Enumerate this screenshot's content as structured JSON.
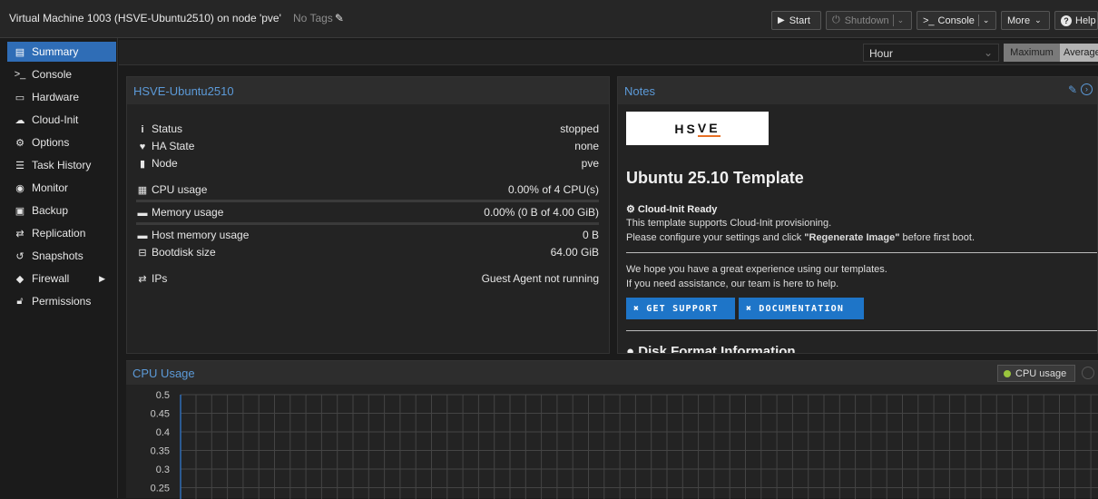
{
  "topbar": {
    "title": "Virtual Machine 1003 (HSVE-Ubuntu2510) on node 'pve'",
    "tags": "No Tags",
    "buttons": {
      "start": "Start",
      "shutdown": "Shutdown",
      "console": "Console",
      "more": "More",
      "help": "Help"
    }
  },
  "sidebar": {
    "items": [
      {
        "label": "Summary",
        "icon": "summary-icon"
      },
      {
        "label": "Console",
        "icon": "terminal-icon"
      },
      {
        "label": "Hardware",
        "icon": "monitor-icon"
      },
      {
        "label": "Cloud-Init",
        "icon": "cloud-icon"
      },
      {
        "label": "Options",
        "icon": "gear-icon"
      },
      {
        "label": "Task History",
        "icon": "list-icon"
      },
      {
        "label": "Monitor",
        "icon": "eye-icon"
      },
      {
        "label": "Backup",
        "icon": "floppy-icon"
      },
      {
        "label": "Replication",
        "icon": "retweet-icon"
      },
      {
        "label": "Snapshots",
        "icon": "history-icon"
      },
      {
        "label": "Firewall",
        "icon": "shield-icon"
      },
      {
        "label": "Permissions",
        "icon": "unlock-icon"
      }
    ]
  },
  "timeframe": {
    "selected": "Hour",
    "maximum": "Maximum",
    "average": "Average"
  },
  "summary": {
    "title": "HSVE-Ubuntu2510",
    "rows": [
      {
        "label": "Status",
        "value": "stopped",
        "icon": "info-icon"
      },
      {
        "label": "HA State",
        "value": "none",
        "icon": "heartbeat-icon"
      },
      {
        "label": "Node",
        "value": "pve",
        "icon": "server-icon"
      },
      {
        "label": "CPU usage",
        "value": "0.00% of 4 CPU(s)",
        "icon": "cpu-icon"
      },
      {
        "label": "Memory usage",
        "value": "0.00% (0 B of 4.00 GiB)",
        "icon": "memory-icon"
      },
      {
        "label": "Host memory usage",
        "value": "0 B",
        "icon": "memory-icon"
      },
      {
        "label": "Bootdisk size",
        "value": "64.00 GiB",
        "icon": "hdd-icon"
      },
      {
        "label": "IPs",
        "value": "Guest Agent not running",
        "icon": "exchange-icon"
      }
    ]
  },
  "notes": {
    "title": "Notes",
    "logo": {
      "top": "HS",
      "bottom": "VE"
    },
    "heading": "Ubuntu 25.10 Template",
    "cloudinit_title": "Cloud-Init Ready",
    "line1": "This template supports Cloud-Init provisioning.",
    "line2_pre": "Please configure your settings and click ",
    "line2_bold": "\"Regenerate Image\"",
    "line2_post": " before first boot.",
    "line3": "We hope you have a great experience using our templates.",
    "line4": "If you need assistance, our team is here to help.",
    "btn_support": "GET SUPPORT",
    "btn_docs": "DOCUMENTATION",
    "disk_title": "Disk Format Information"
  },
  "cpu_chart": {
    "title": "CPU Usage",
    "legend": "CPU usage",
    "legend_color": "#9ac53d"
  },
  "chart_data": {
    "type": "line",
    "title": "CPU Usage",
    "series": [
      {
        "name": "CPU usage",
        "values": []
      }
    ],
    "y_ticks": [
      "0.5",
      "0.45",
      "0.4",
      "0.35",
      "0.3",
      "0.25"
    ],
    "ylim": [
      0.25,
      0.5
    ],
    "grid": true,
    "legend_placement": "top-right"
  },
  "colors": {
    "accent": "#2f6db6",
    "header_text": "#5c9ad8",
    "button_blue": "#1e75c8"
  }
}
